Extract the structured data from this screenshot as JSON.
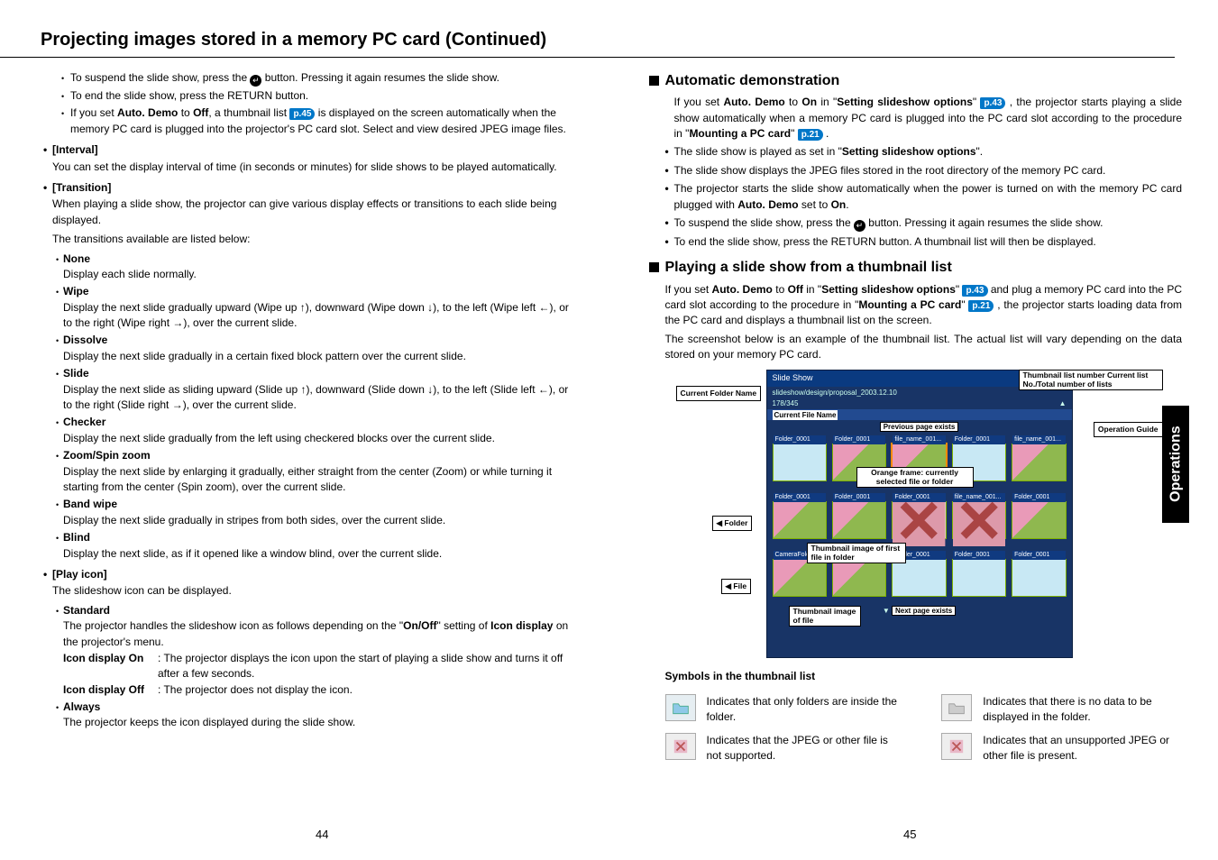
{
  "title": "Projecting images stored in a memory PC card (Continued)",
  "pageLeft": "44",
  "pageRight": "45",
  "sideTab": "Operations",
  "left": {
    "b1a": "To suspend the slide show, press the ",
    "b1b": " button. Pressing it again resumes the slide show.",
    "b2": "To end the slide show, press the RETURN button.",
    "b3a": "If you set ",
    "b3b": "Auto. Demo",
    "b3c": " to ",
    "b3d": "Off",
    "b3e": ", a thumbnail list ",
    "b3f": "p.45",
    "b3g": " is displayed on the screen automatically when the memory PC card is plugged into the projector's PC card slot. Select and view desired JPEG image files.",
    "intervalH": "[Interval]",
    "intervalB": "You can set the display interval of time (in seconds or minutes) for slide shows to be played automatically.",
    "transH": "[Transition]",
    "transB1": "When playing a slide show, the projector can give various display effects or transitions to each slide being displayed.",
    "transB2": "The transitions available are listed below:",
    "noneH": "None",
    "noneB": "Display each slide normally.",
    "wipeH": "Wipe",
    "wipeB": "Display the next slide gradually upward (Wipe up ↑), downward (Wipe down ↓), to the left (Wipe left ←), or to the right (Wipe right →), over the current slide.",
    "dissH": "Dissolve",
    "dissB": "Display the next slide gradually in a certain fixed block pattern over the current slide.",
    "slideH": "Slide",
    "slideB": "Display the next slide as sliding upward (Slide up ↑), downward (Slide down ↓), to the left (Slide left ←), or to the right (Slide right →), over the current slide.",
    "checkH": "Checker",
    "checkB": "Display the next slide gradually from the left using checkered blocks over the current slide.",
    "zoomH": "Zoom/Spin zoom",
    "zoomB": "Display the next slide by enlarging it gradually, either straight from the center (Zoom) or while turning it starting from the center (Spin zoom), over the current slide.",
    "bandH": "Band wipe",
    "bandB": "Display the next slide gradually in stripes from both sides, over the current slide.",
    "blindH": "Blind",
    "blindB": "Display the next slide, as if it opened like a window blind, over the current slide.",
    "playH": "[Play icon]",
    "playB": "The slideshow icon can be displayed.",
    "stdH": "Standard",
    "stdB1a": "The projector handles the slideshow icon as follows depending on the \"",
    "stdB1b": "On/Off",
    "stdB1c": "\" setting of ",
    "stdB1d": "Icon display",
    "stdB1e": " on the projector's menu.",
    "onLbl": "Icon display On",
    "onTxt": ":   The projector displays the icon upon the start of playing a slide show and turns it off after a few seconds.",
    "offLbl": "Icon display Off",
    "offTxt": ":  The projector does not display the icon.",
    "alwH": "Always",
    "alwB": "The projector keeps the icon displayed during the slide show."
  },
  "right": {
    "h1": "Automatic demonstration",
    "a1a": "If you set ",
    "a1b": "Auto. Demo",
    "a1c": " to ",
    "a1d": "On",
    "a1e": " in \"",
    "a1f": "Setting slideshow options",
    "a1g": "\" ",
    "a1h": "p.43",
    "a1i": " , the projector starts playing a slide show automatically when a memory PC card is plugged into the PC card slot according to the procedure in \"",
    "a1j": "Mounting a PC card",
    "a1k": "\" ",
    "a1l": "p.21",
    "a1m": " .",
    "a2a": "The slide show is played as set in \"",
    "a2b": "Setting slideshow options",
    "a2c": "\".",
    "a3": "The slide show displays the JPEG files stored in the root directory of the memory PC card.",
    "a4a": "The projector starts the slide show automatically when the power is turned on with the memory PC card plugged with ",
    "a4b": "Auto. Demo",
    "a4c": " set to ",
    "a4d": "On",
    "a4e": ".",
    "a5a": "To suspend the slide show, press the ",
    "a5b": " button. Pressing it again resumes the slide show.",
    "a6": "To end the slide show, press the RETURN button. A thumbnail list will then be displayed.",
    "h2": "Playing a slide show from a thumbnail list",
    "p1a": "If you set ",
    "p1b": "Auto. Demo",
    "p1c": " to ",
    "p1d": "Off",
    "p1e": " in \"",
    "p1f": "Setting slideshow options",
    "p1g": "\" ",
    "p1h": "p.43",
    "p1i": "  and plug a memory PC card into the PC card slot according to the procedure in \"",
    "p1j": "Mounting a PC card",
    "p1k": "\" ",
    "p1l": "p.21",
    "p1m": " , the projector starts loading data from the PC card and displays a thumbnail list on the screen.",
    "p2": "The screenshot below is an example of the thumbnail list. The actual list will vary depending on the data stored on your memory PC card.",
    "fig": {
      "title": "Slide Show",
      "path": "slideshow/design/proposal_2003.12.10",
      "counter": "178/345",
      "currentFileName": "Current File Name",
      "l_curFolder": "Current Folder Name",
      "l_thumbNum": "Thumbnail list number\nCurrent list No./Total number of lists",
      "l_prev": "Previous page exists",
      "l_opGuide": "Operation Guide",
      "l_orange": "Orange frame: currently selected file or folder",
      "l_folder": "Folder",
      "l_thumbFirst": "Thumbnail image of first file in folder",
      "l_file": "File",
      "l_thumbFile": "Thumbnail image of file",
      "l_next": "Next page exists"
    },
    "symHead": "Symbols in the thumbnail list",
    "sym1": "Indicates that only folders are inside the folder.",
    "sym2": "Indicates that the JPEG or other file is not supported.",
    "sym3": "Indicates that there is no data to be displayed in the folder.",
    "sym4": "Indicates that an unsupported JPEG or other file is present."
  }
}
